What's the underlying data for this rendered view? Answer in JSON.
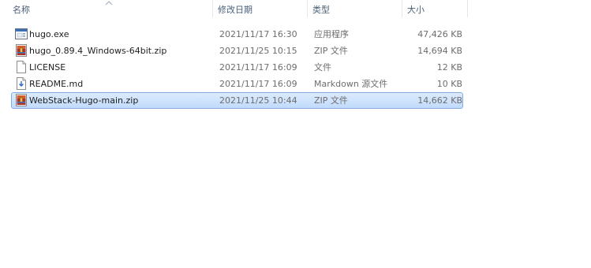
{
  "columns": {
    "name": "名称",
    "date": "修改日期",
    "type": "类型",
    "size": "大小",
    "sort": "name-ascending"
  },
  "files": [
    {
      "name": "hugo.exe",
      "date": "2021/11/17 16:30",
      "type": "应用程序",
      "size": "47,426 KB",
      "icon": "exe-icon",
      "selected": false
    },
    {
      "name": "hugo_0.89.4_Windows-64bit.zip",
      "date": "2021/11/25 10:15",
      "type": "ZIP 文件",
      "size": "14,694 KB",
      "icon": "zip-archive-icon",
      "selected": false
    },
    {
      "name": "LICENSE",
      "date": "2021/11/17 16:09",
      "type": "文件",
      "size": "12 KB",
      "icon": "blank-file-icon",
      "selected": false
    },
    {
      "name": "README.md",
      "date": "2021/11/17 16:09",
      "type": "Markdown 源文件",
      "size": "10 KB",
      "icon": "markdown-file-icon",
      "selected": false
    },
    {
      "name": "WebStack-Hugo-main.zip",
      "date": "2021/11/25 10:44",
      "type": "ZIP 文件",
      "size": "14,662 KB",
      "icon": "zip-archive-icon",
      "selected": true
    }
  ],
  "colors": {
    "selection_fill": "#cce3fb",
    "selection_border": "#84acdd",
    "header_text": "#4c607a",
    "detail_text": "#6d6d6d"
  }
}
